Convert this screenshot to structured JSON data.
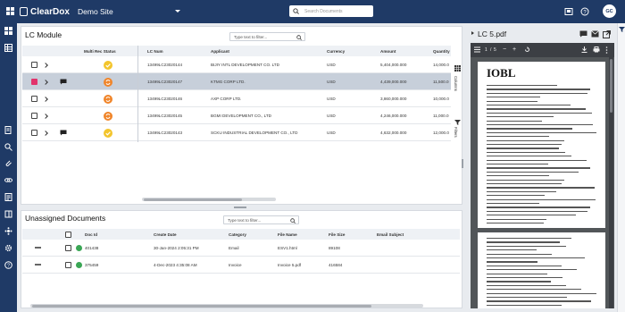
{
  "topbar": {
    "app_name": "ClearDox",
    "site_name": "Demo Site",
    "search_placeholder": "Search Documents",
    "avatar_initials": "GC",
    "colors": {
      "topbar": "#1f3a66",
      "accent": "#e2336b"
    }
  },
  "lc_panel": {
    "title": "LC Module",
    "filter_placeholder": "Type text to filter...",
    "columns": [
      "Multi Rec Status",
      "LC Num",
      "Applicant",
      "Currency",
      "Amount",
      "Quantity"
    ],
    "side_tabs": [
      "Columns",
      "Filters"
    ],
    "rows": [
      {
        "lc_num": "13499LC23020144",
        "applicant": "BIJIY INTL DEVELOPMENT CO. LTD",
        "currency": "USD",
        "amount": "5,404,000.000",
        "quantity": "14,000.0",
        "status": "ok",
        "selected": false,
        "comment": false
      },
      {
        "lc_num": "13499LC23020147",
        "applicant": "KTMG CORP LTD.",
        "currency": "USD",
        "amount": "4,439,000.000",
        "quantity": "11,500.0",
        "status": "warn",
        "selected": true,
        "comment": true
      },
      {
        "lc_num": "13499LC23020146",
        "applicant": "AXP CORP LTD.",
        "currency": "USD",
        "amount": "3,860,000.000",
        "quantity": "10,000.0",
        "status": "warn",
        "selected": false,
        "comment": false
      },
      {
        "lc_num": "13499LC23020145",
        "applicant": "BGMI DEVELOPMENT CO., LTD",
        "currency": "USD",
        "amount": "4,246,000.000",
        "quantity": "11,000.0",
        "status": "warn",
        "selected": false,
        "comment": false
      },
      {
        "lc_num": "13499LC23020143",
        "applicant": "SCKU INDUSTRIAL DEVELOPMENT CO., LTD",
        "currency": "USD",
        "amount": "4,632,000.000",
        "quantity": "12,000.0",
        "status": "ok",
        "selected": false,
        "comment": true
      }
    ]
  },
  "docs_panel": {
    "title": "Unassigned Documents",
    "filter_placeholder": "Type text to filter...",
    "columns": [
      "Doc Id",
      "Create Date",
      "Category",
      "File Name",
      "File Size",
      "Email Subject"
    ],
    "rows": [
      {
        "doc_id": "401438",
        "create_date": "30-Jan-2024 2:05:31 PM",
        "category": "Email",
        "file_name": "ESV1.html",
        "file_size": "89108",
        "email_subject": ""
      },
      {
        "doc_id": "375459",
        "create_date": "4-Dec-2023 4:35:08 AM",
        "category": "Invoice",
        "file_name": "Invoice 5.pdf",
        "file_size": "416584",
        "email_subject": ""
      }
    ]
  },
  "viewer": {
    "title": "LC 5.pdf",
    "page_current": "1",
    "page_total": "5",
    "doc_heading": "IOBL"
  }
}
